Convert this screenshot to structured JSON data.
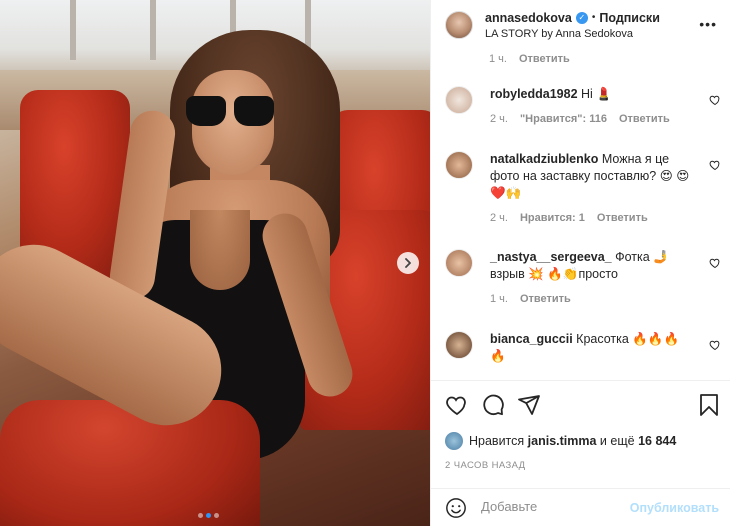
{
  "post": {
    "carousel": {
      "total_slides": 3,
      "active_slide": 2
    }
  },
  "header": {
    "username": "annasedokova",
    "separator": "•",
    "follow_label": "Подписки",
    "location": "LA STORY by Anna Sedokova",
    "more_icon": "more-horizontal-icon"
  },
  "partial_comment": {
    "time": "1 ч.",
    "reply": "Ответить"
  },
  "comments": [
    {
      "username": "robyledda1982",
      "text": "Hi 💄",
      "time": "2 ч.",
      "likes": "\"Нравится\": 116",
      "reply": "Ответить"
    },
    {
      "username": "natalkadziublenko",
      "text": "Можна я це фото на заставку поставлю? 😍 😍❤️🙌",
      "time": "2 ч.",
      "likes": "Нравится: 1",
      "reply": "Ответить"
    },
    {
      "username": "_nastya__sergeeva_",
      "text": "Фотка 🤳 взрыв 💥 🔥👏просто",
      "time": "1 ч.",
      "likes": "",
      "reply": "Ответить"
    },
    {
      "username": "bianca_guccii",
      "text": "Красотка 🔥🔥🔥 🔥",
      "time": "",
      "likes": "",
      "reply": ""
    }
  ],
  "likes": {
    "prefix": "Нравится",
    "user": "janis.timma",
    "middle": "и ещё",
    "count": "16 844"
  },
  "date": "2 ЧАСОВ НАЗАД",
  "add_comment": {
    "placeholder": "Добавьте",
    "publish": "Опубликовать"
  },
  "colors": {
    "accent": "#3897f0",
    "publish_disabled": "#b2dffc",
    "muted": "#8e8e8e",
    "text": "#262626"
  }
}
